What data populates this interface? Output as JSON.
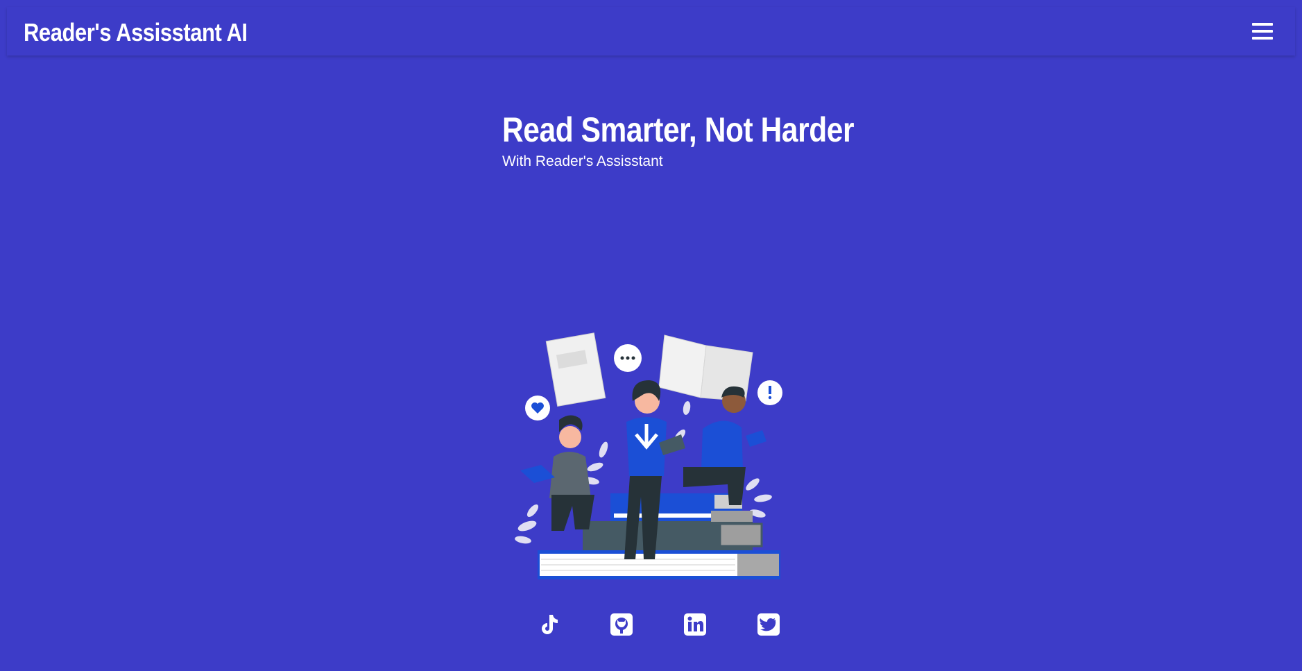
{
  "header": {
    "brand": "Reader's Assisstant AI",
    "menu_icon": "hamburger-menu-icon"
  },
  "hero": {
    "title": "Read Smarter, Not Harder",
    "subtitle": "With Reader's Assisstant"
  },
  "illustration": {
    "name": "people-reading-books-illustration"
  },
  "socials": [
    {
      "icon": "tiktok-icon"
    },
    {
      "icon": "github-icon"
    },
    {
      "icon": "linkedin-icon"
    },
    {
      "icon": "twitter-icon"
    }
  ],
  "colors": {
    "background": "#3d3cc8",
    "text": "#ffffff",
    "accent": "#1b4fd6",
    "dark": "#263238"
  }
}
